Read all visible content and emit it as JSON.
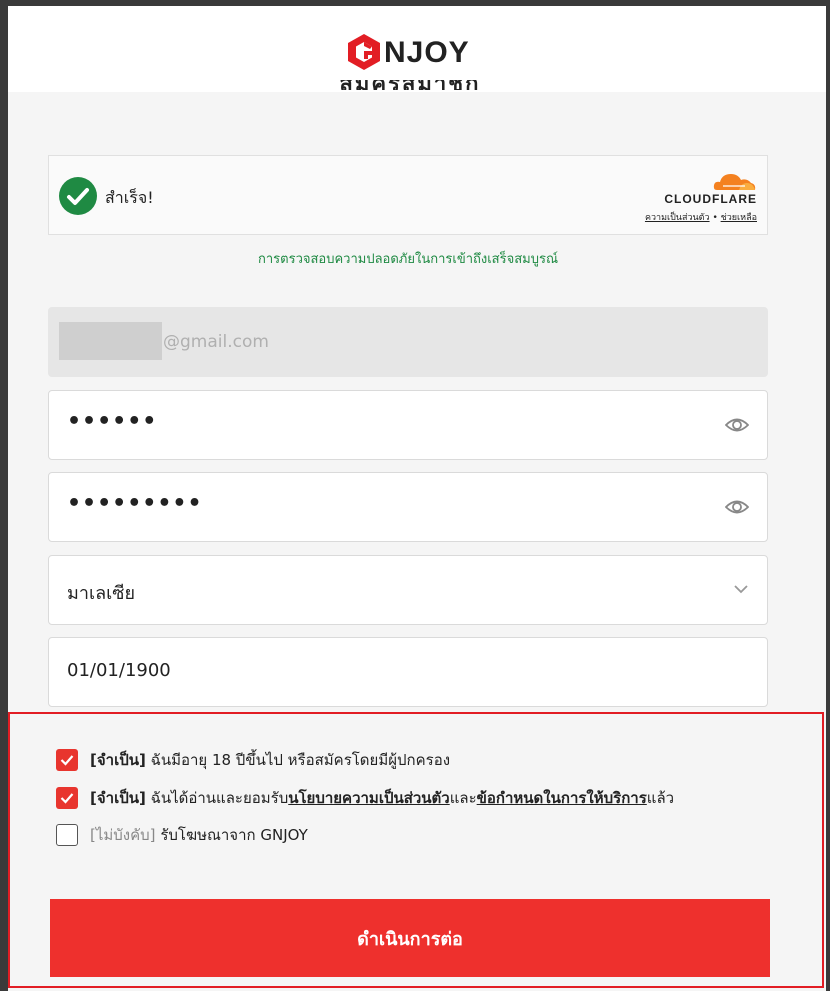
{
  "brand": {
    "logo_text": "NJOY",
    "accent": "#e8352e"
  },
  "page": {
    "title_partial": "สมัครสมาชิก"
  },
  "captcha": {
    "status_text": "สำเร็จ!",
    "provider": "CLOUDFLARE",
    "privacy_link": "ความเป็นส่วนตัว",
    "separator": "•",
    "help_link": "ช่วยเหลือ",
    "verify_message": "การตรวจสอบความปลอดภัยในการเข้าถึงเสร็จสมบูรณ์"
  },
  "form": {
    "email_domain": "@gmail.com",
    "password_mask": "••••••",
    "confirm_password_mask": "•••••••••",
    "country_value": "มาเลเซีย",
    "birthdate_value": "01/01/1900"
  },
  "consents": [
    {
      "tag": "[จำเป็น]",
      "text": " ฉันมีอายุ 18 ปีขึ้นไป หรือสมัครโดยมีผู้ปกครอง",
      "checked": true
    },
    {
      "tag": "[จำเป็น]",
      "text_pre": " ฉันได้อ่านและยอมรับ",
      "link1": "นโยบายความเป็นส่วนตัว",
      "text_mid": "และ",
      "link2": "ข้อกำหนดในการให้บริการ",
      "text_post": "แล้ว",
      "checked": true
    },
    {
      "tag": "[ไม่บังคับ]",
      "text": " รับโฆษณาจาก GNJOY",
      "checked": false
    }
  ],
  "submit_label": "ดำเนินการต่อ",
  "icons": {
    "captcha_status": "check-circle-icon",
    "password_toggle": "eye-icon",
    "select": "chevron-down-icon"
  }
}
